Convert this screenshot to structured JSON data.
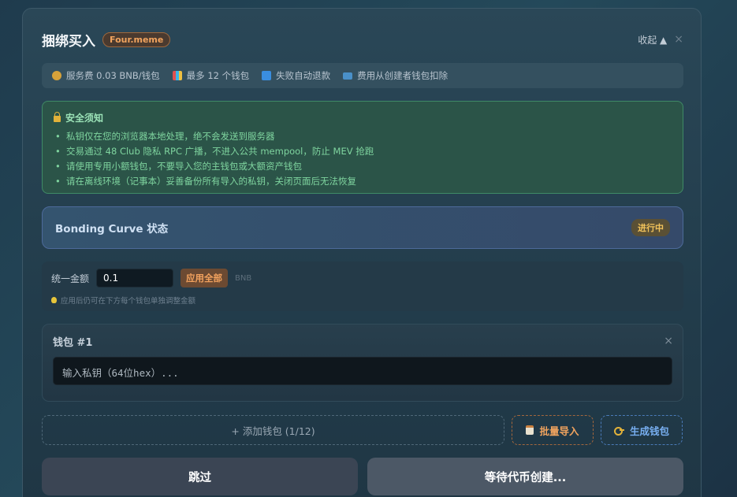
{
  "header": {
    "title": "捆绑买入",
    "platform_tag": "Four.meme",
    "collapse_label": "收起 ▲",
    "close_label": "×"
  },
  "infobar": [
    {
      "icon": "money-bag-icon",
      "text": "服务费 0.03 BNB/钱包"
    },
    {
      "icon": "chart-icon",
      "text": "最多 12 个钱包"
    },
    {
      "icon": "refresh-icon",
      "text": "失败自动退款"
    },
    {
      "icon": "credit-card-icon",
      "text": "费用从创建者钱包扣除"
    }
  ],
  "notice": {
    "title": "安全须知",
    "items": [
      "私钥仅在您的浏览器本地处理，绝不会发送到服务器",
      "交易通过 48 Club 隐私 RPC 广播，不进入公共 mempool，防止 MEV 抢跑",
      "请使用专用小额钱包，不要导入您的主钱包或大额资产钱包",
      "请在离线环境（记事本）妥善备份所有导入的私钥，关闭页面后无法恢复"
    ]
  },
  "bonding": {
    "title": "Bonding Curve 状态",
    "status": "进行中"
  },
  "amount": {
    "label": "统一金额",
    "value": "0.1",
    "apply_label": "应用全部",
    "unit": "BNB",
    "hint": "应用后仍可在下方每个钱包单独调整金额"
  },
  "wallet": {
    "title": "钱包 #1",
    "close_label": "×",
    "placeholder": "输入私钥（64位hex）..."
  },
  "actions": {
    "add_label": "+ 添加钱包 (1/12)",
    "batch_label": "批量导入",
    "generate_label": "生成钱包"
  },
  "bottom": {
    "skip_label": "跳过",
    "wait_label": "等待代币创建..."
  },
  "colors": {
    "accent_orange": "#f0a35e",
    "success_green": "#7fd59f",
    "status_yellow": "#f2c35b",
    "link_blue": "#77aef0"
  }
}
